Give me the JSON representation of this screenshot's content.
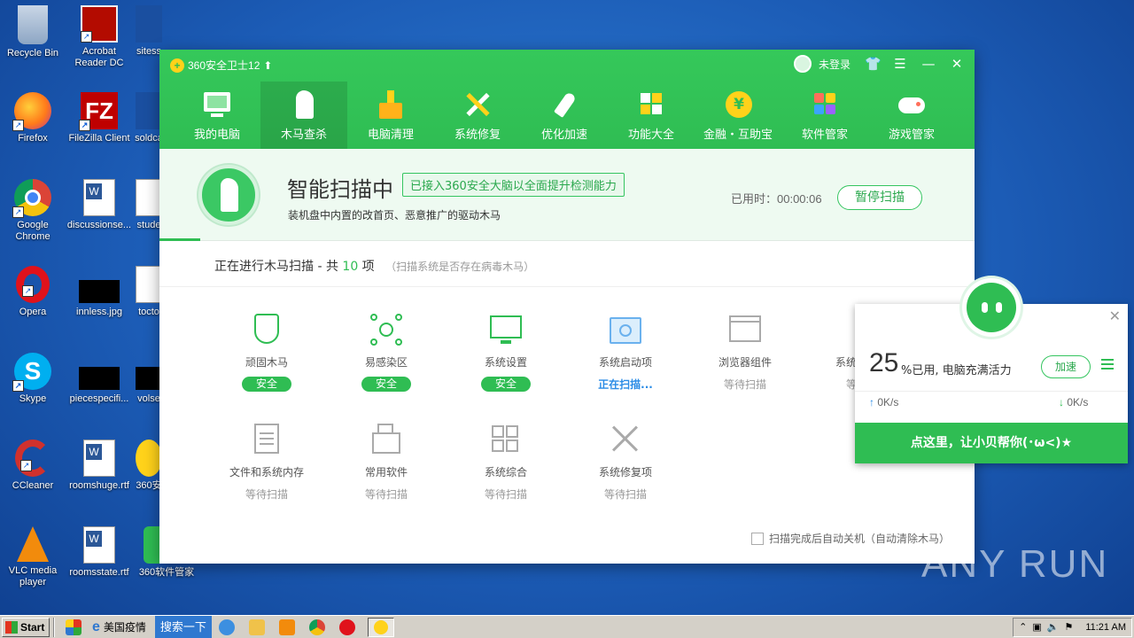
{
  "desktop": {
    "icons": [
      {
        "label": "Recycle Bin"
      },
      {
        "label": "Acrobat Reader DC"
      },
      {
        "label": "sitess"
      },
      {
        "label": "Firefox"
      },
      {
        "label": "FileZilla Client"
      },
      {
        "label": "soldca"
      },
      {
        "label": "Google Chrome"
      },
      {
        "label": "discussionse..."
      },
      {
        "label": "stude"
      },
      {
        "label": "Opera"
      },
      {
        "label": "innless.jpg"
      },
      {
        "label": "tocto"
      },
      {
        "label": "Skype"
      },
      {
        "label": "piecespecifi..."
      },
      {
        "label": "volse"
      },
      {
        "label": "CCleaner"
      },
      {
        "label": "roomshuge.rtf"
      },
      {
        "label": "360安"
      },
      {
        "label": "VLC media player"
      },
      {
        "label": "roomsstate.rtf"
      },
      {
        "label": "360软件管家"
      }
    ]
  },
  "window": {
    "title": "360安全卫士12",
    "login": "未登录",
    "nav": [
      {
        "label": "我的电脑"
      },
      {
        "label": "木马查杀"
      },
      {
        "label": "电脑清理"
      },
      {
        "label": "系统修复"
      },
      {
        "label": "优化加速"
      },
      {
        "label": "功能大全"
      },
      {
        "label": "金融・互助宝"
      },
      {
        "label": "软件管家"
      },
      {
        "label": "游戏管家"
      }
    ],
    "scan": {
      "title": "智能扫描中",
      "badge": "已接入360安全大脑以全面提升检测能力",
      "subtitle": "装机盘中内置的改首页、恶意推广的驱动木马",
      "time_label": "已用时：00:00:06",
      "pause": "暂停扫描",
      "status_prefix": "正在进行木马扫描 - 共 ",
      "status_count": "10",
      "status_suffix": " 项",
      "status_hint": "（扫描系统是否存在病毒木马）"
    },
    "items": [
      {
        "label": "顽固木马",
        "state": "安全"
      },
      {
        "label": "易感染区",
        "state": "安全"
      },
      {
        "label": "系统设置",
        "state": "安全"
      },
      {
        "label": "系统启动项",
        "state": "正在扫描..."
      },
      {
        "label": "浏览器组件",
        "state": "等待扫描"
      },
      {
        "label": "系统设",
        "state": "等"
      },
      {
        "label": "文件和系统内存",
        "state": "等待扫描"
      },
      {
        "label": "常用软件",
        "state": "等待扫描"
      },
      {
        "label": "系统综合",
        "state": "等待扫描"
      },
      {
        "label": "系统修复项",
        "state": "等待扫描"
      }
    ],
    "auto_shutdown": "扫描完成后自动关机（自动清除木马）"
  },
  "widget": {
    "percent": "25",
    "used_text": "%已用, 电脑充满活力",
    "speed_btn": "加速",
    "up": "0K/s",
    "down": "0K/s",
    "cta": "点这里，让小贝帮你(･ω<)★"
  },
  "watermark": "ANY RUN",
  "taskbar": {
    "start": "Start",
    "ie_label": "美国疫情",
    "search": "搜索一下",
    "clock": "11:21 AM"
  },
  "colors": {
    "brand_green": "#2fbd53",
    "desktop_blue": "#1d5fb8"
  }
}
